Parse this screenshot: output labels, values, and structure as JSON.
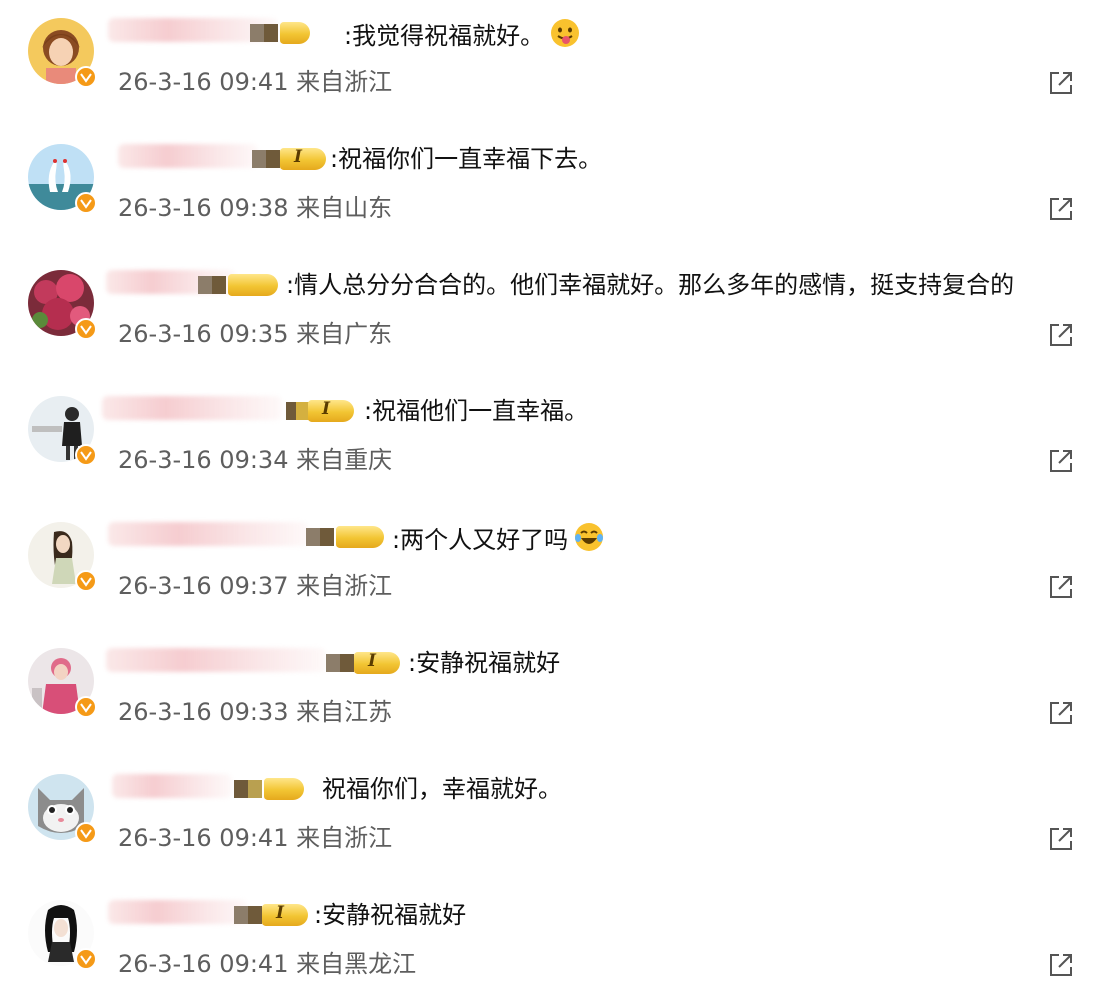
{
  "comments": [
    {
      "text": ":我觉得祝福就好。",
      "emoji": "tongue-emoji",
      "time": "26-3-16 09:41 来自浙江"
    },
    {
      "text": ":祝福你们一直幸福下去。",
      "time": "26-3-16 09:38 来自山东"
    },
    {
      "text": ":情人总分分合合的。他们幸福就好。那么多年的感情，挺支持复合的",
      "time": "26-3-16 09:35 来自广东"
    },
    {
      "text": ":祝福他们一直幸福。",
      "time": "26-3-16 09:34 来自重庆"
    },
    {
      "text": ":两个人又好了吗",
      "emoji": "laughing-tears-emoji",
      "time": "26-3-16 09:37 来自浙江"
    },
    {
      "text": ":安静祝福就好",
      "time": "26-3-16 09:33 来自江苏"
    },
    {
      "text": "祝福你们，幸福就好。",
      "time": "26-3-16 09:41 来自浙江"
    },
    {
      "text": ":安静祝福就好",
      "time": "26-3-16 09:41 来自黑龙江"
    }
  ],
  "level_badge": "I",
  "colors": {
    "accent": "#f59a17",
    "badge_gold": "#f2c533",
    "meta": "#5e5e5e"
  }
}
